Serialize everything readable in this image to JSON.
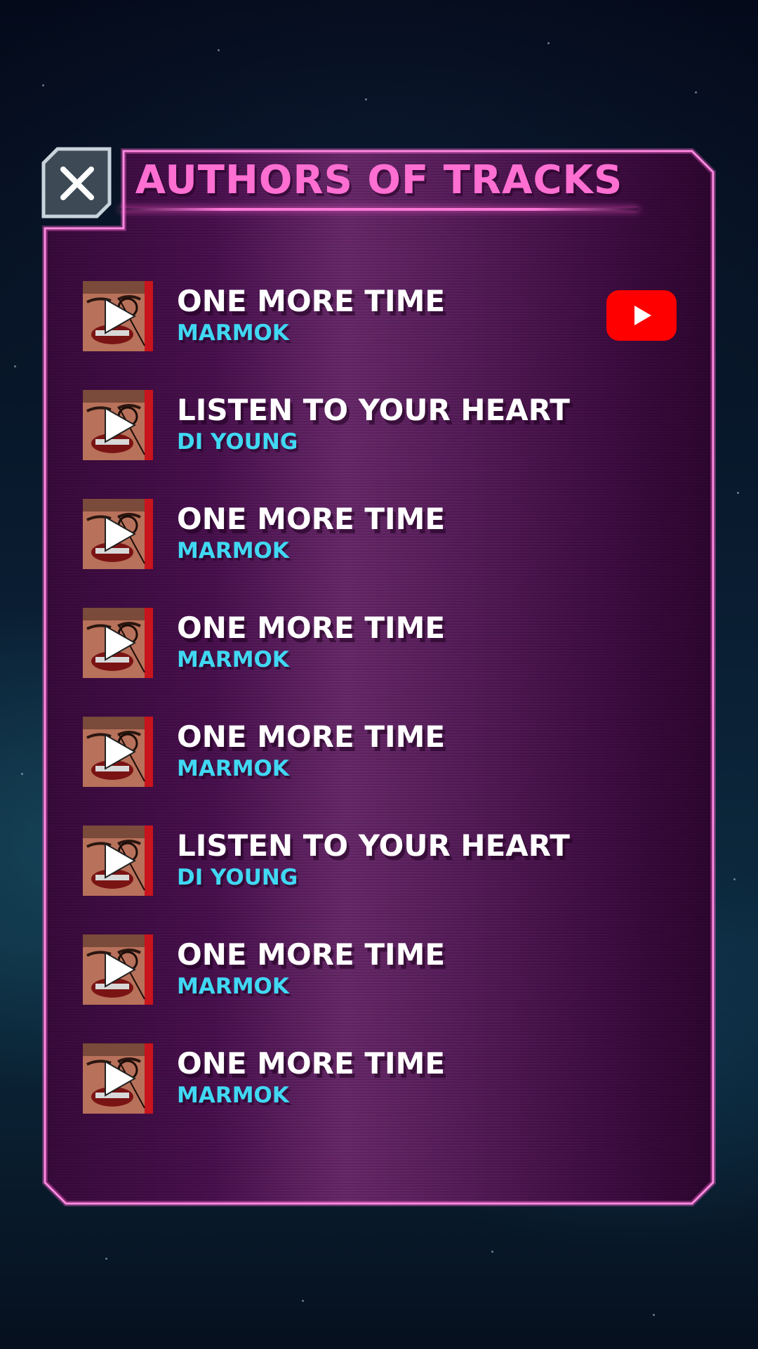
{
  "header": {
    "title": "AUTHORS OF TRACKS",
    "close_icon": "close-icon"
  },
  "colors": {
    "accent_pink": "#ff6fd2",
    "author_cyan": "#40d8f2",
    "youtube_red": "#ff0000"
  },
  "tracks": [
    {
      "title": "ONE MORE TIME",
      "author": "MARMOK",
      "youtube_button": true
    },
    {
      "title": "LISTEN TO YOUR HEART",
      "author": "DI YOUNG",
      "youtube_button": false
    },
    {
      "title": "ONE MORE TIME",
      "author": "MARMOK",
      "youtube_button": false
    },
    {
      "title": "ONE MORE TIME",
      "author": "MARMOK",
      "youtube_button": false
    },
    {
      "title": "ONE MORE TIME",
      "author": "MARMOK",
      "youtube_button": false
    },
    {
      "title": "LISTEN TO YOUR HEART",
      "author": "DI YOUNG",
      "youtube_button": false
    },
    {
      "title": "ONE MORE TIME",
      "author": "MARMOK",
      "youtube_button": false
    },
    {
      "title": "ONE MORE TIME",
      "author": "MARMOK",
      "youtube_button": false
    }
  ],
  "icons": {
    "thumbnail_overlay": "play-icon",
    "link": "youtube-icon"
  }
}
